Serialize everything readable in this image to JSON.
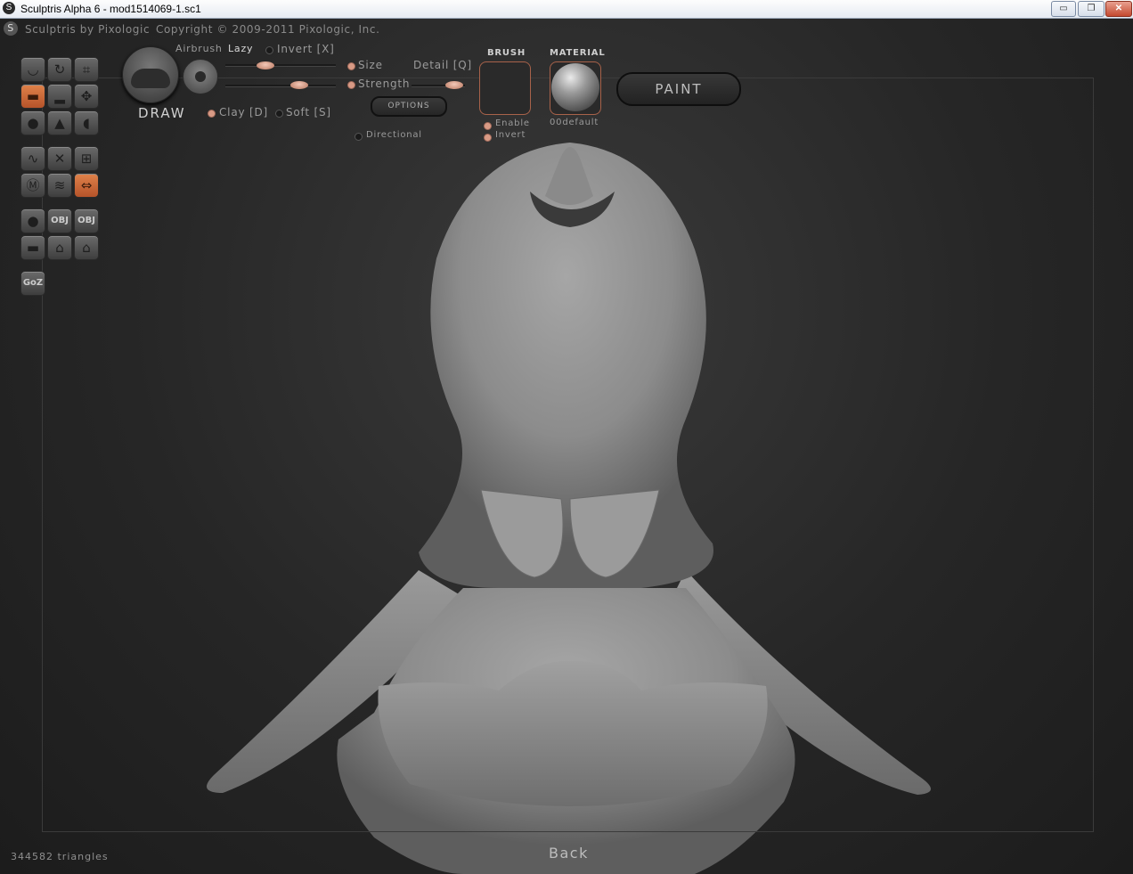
{
  "window": {
    "title": "Sculptris Alpha 6 - mod1514069-1.sc1",
    "minimize": "▭",
    "maximize": "❐",
    "close": "✕"
  },
  "header": {
    "brand": "Sculptris by Pixologic",
    "copyright": "Copyright © 2009-2011 Pixologic, Inc."
  },
  "brush_panel": {
    "tool_name": "DRAW",
    "airbrush": "Airbrush",
    "lazy": "Lazy",
    "invert": "Invert [X]",
    "size": "Size",
    "detail": "Detail [Q]",
    "strength": "Strength",
    "clay": "Clay [D]",
    "soft": "Soft [S]",
    "options": "OPTIONS",
    "directional": "Directional"
  },
  "brush": {
    "heading": "BRUSH",
    "enable": "Enable",
    "invert": "Invert"
  },
  "material": {
    "heading": "MATERIAL",
    "name": "00default"
  },
  "paint_button": "PAINT",
  "tools": {
    "goz": "GoZ",
    "obj1": "OBJ",
    "obj2": "OBJ"
  },
  "status": {
    "triangles": "344582 triangles"
  },
  "back": "Back",
  "colors": {
    "accent": "#c9683a",
    "knob": "#e0a893",
    "background": "#262626"
  }
}
